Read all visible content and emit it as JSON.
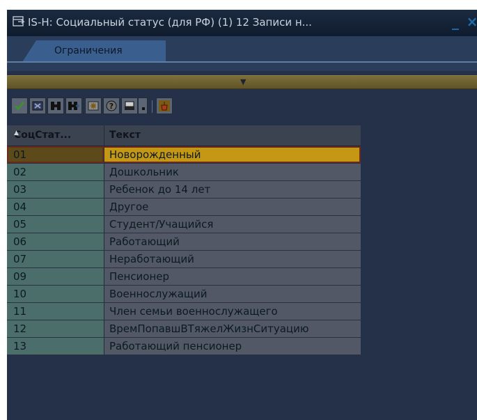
{
  "window": {
    "title": "IS-H: Социальный статус (для РФ) (1)   12 Записи н...",
    "minimize_icon": "minimize-icon",
    "close_icon": "close-icon"
  },
  "tabs": [
    {
      "label": "Ограничения"
    }
  ],
  "toolbar": {
    "buttons": [
      "check-icon",
      "cancel-icon",
      "find-icon",
      "find-next-icon",
      "snapshot-icon",
      "help-icon",
      "print-icon",
      "print-dropdown-icon",
      "filter-icon"
    ]
  },
  "table": {
    "columns": [
      "СоцСтат...",
      "Текст"
    ],
    "rows": [
      {
        "key": "01",
        "text": "Новорожденный",
        "selected": true
      },
      {
        "key": "02",
        "text": "Дошкольник"
      },
      {
        "key": "03",
        "text": "Ребенок до 14 лет"
      },
      {
        "key": "04",
        "text": "Другое"
      },
      {
        "key": "05",
        "text": "Студент/Учащийся"
      },
      {
        "key": "06",
        "text": "Работающий"
      },
      {
        "key": "07",
        "text": "Неработающий"
      },
      {
        "key": "09",
        "text": "Пенсионер"
      },
      {
        "key": "10",
        "text": "Военнослужащий"
      },
      {
        "key": "11",
        "text": "Член семьи военнослужащего"
      },
      {
        "key": "12",
        "text": "ВремПопавшВТяжелЖизнСитуацию"
      },
      {
        "key": "13",
        "text": "Работающий пенсионер"
      }
    ]
  },
  "colors": {
    "selected_row": "#c49814",
    "key_column": "#4c6e6a",
    "text_column": "#525866",
    "background": "#243148"
  }
}
